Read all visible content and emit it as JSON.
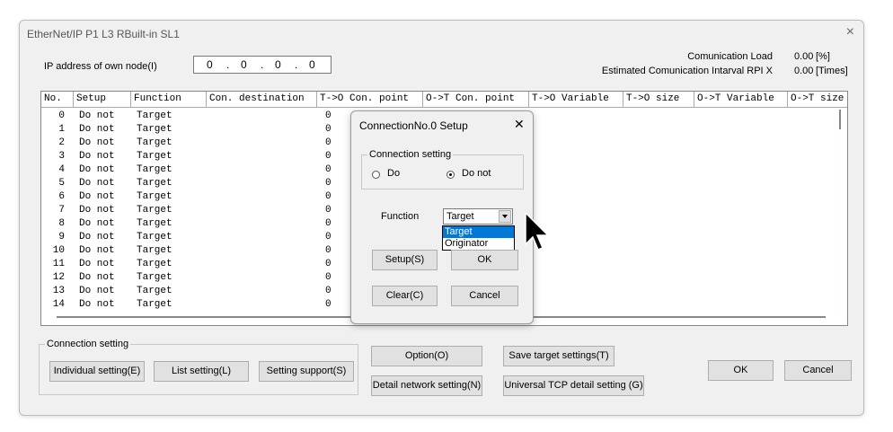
{
  "window": {
    "title": "EtherNet/IP  P1 L3 RBuilt-in SL1",
    "close": "×"
  },
  "ip": {
    "label": "IP address of own node(I)",
    "octets": [
      "0",
      "0",
      "0",
      "0"
    ],
    "dot": "."
  },
  "stats": {
    "load_label": "Comunication Load",
    "load_value": "0.00",
    "load_unit": "[%]",
    "rpi_label": "Estimated Comunication Intarval RPI X",
    "rpi_value": "0.00",
    "rpi_unit": "[Times]"
  },
  "table": {
    "columns": [
      "No.",
      "Setup",
      "Function",
      "Con. destination",
      "T->O Con. point",
      "O->T Con. point",
      "T->O Variable",
      "T->O size",
      "O->T Variable",
      "O->T size"
    ],
    "rows": [
      {
        "no": "0",
        "setup": "Do not",
        "function": "Target",
        "to_point": "0"
      },
      {
        "no": "1",
        "setup": "Do not",
        "function": "Target",
        "to_point": "0"
      },
      {
        "no": "2",
        "setup": "Do not",
        "function": "Target",
        "to_point": "0"
      },
      {
        "no": "3",
        "setup": "Do not",
        "function": "Target",
        "to_point": "0"
      },
      {
        "no": "4",
        "setup": "Do not",
        "function": "Target",
        "to_point": "0"
      },
      {
        "no": "5",
        "setup": "Do not",
        "function": "Target",
        "to_point": "0"
      },
      {
        "no": "6",
        "setup": "Do not",
        "function": "Target",
        "to_point": "0"
      },
      {
        "no": "7",
        "setup": "Do not",
        "function": "Target",
        "to_point": "0"
      },
      {
        "no": "8",
        "setup": "Do not",
        "function": "Target",
        "to_point": "0"
      },
      {
        "no": "9",
        "setup": "Do not",
        "function": "Target",
        "to_point": "0"
      },
      {
        "no": "10",
        "setup": "Do not",
        "function": "Target",
        "to_point": "0"
      },
      {
        "no": "11",
        "setup": "Do not",
        "function": "Target",
        "to_point": "0"
      },
      {
        "no": "12",
        "setup": "Do not",
        "function": "Target",
        "to_point": "0"
      },
      {
        "no": "13",
        "setup": "Do not",
        "function": "Target",
        "to_point": "0"
      },
      {
        "no": "14",
        "setup": "Do not",
        "function": "Target",
        "to_point": "0"
      }
    ]
  },
  "connection_group": {
    "label": "Connection setting",
    "individual": "Individual setting(E)",
    "list": "List setting(L)",
    "support": "Setting support(S)"
  },
  "buttons": {
    "option": "Option(O)",
    "detail_network": "Detail network setting(N)",
    "save_target": "Save target settings(T)",
    "universal_tcp": "Universal TCP detail setting (G)",
    "ok": "OK",
    "cancel": "Cancel"
  },
  "dialog": {
    "title": "ConnectionNo.0 Setup",
    "close": "✕",
    "group_label": "Connection setting",
    "radio_do": "Do",
    "radio_do_not": "Do not",
    "selected_radio": "Do not",
    "function_label": "Function",
    "function_value": "Target",
    "options": [
      "Target",
      "Originator"
    ],
    "setup_btn": "Setup(S)",
    "ok_btn": "OK",
    "clear_btn": "Clear(C)",
    "cancel_btn": "Cancel"
  }
}
